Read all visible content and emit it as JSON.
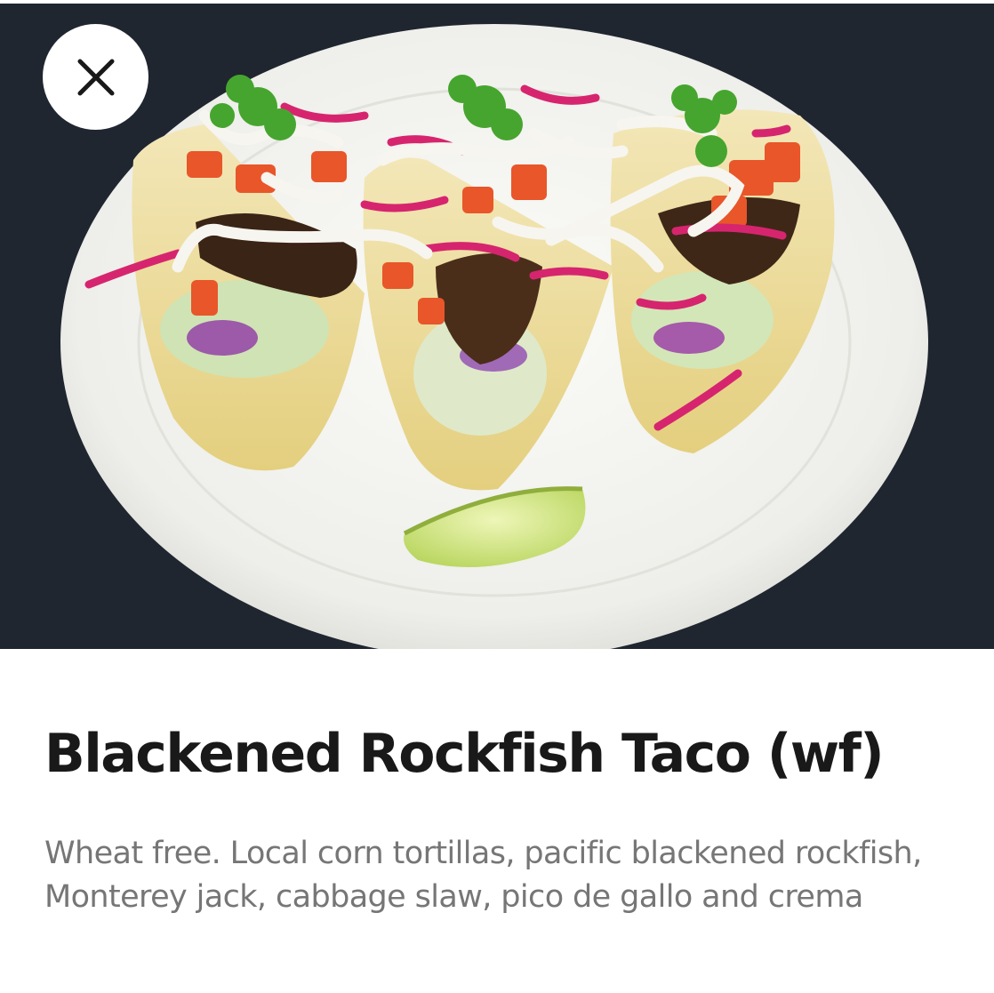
{
  "item": {
    "title": "Blackened Rockfish Taco (wf)",
    "description": "Wheat free. Local corn tortillas, pacific blackened rockfish, Monterey jack, cabbage slaw, pico de gallo and crema"
  },
  "close_button": {
    "icon": "close-icon",
    "aria_label": "Close"
  },
  "colors": {
    "background": "#ffffff",
    "title": "#191919",
    "description": "#767676",
    "photo_backdrop": "#1f2630"
  }
}
